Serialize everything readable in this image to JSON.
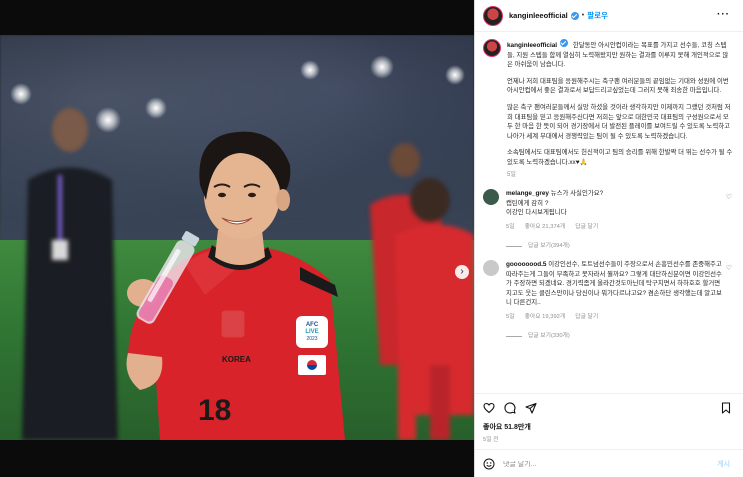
{
  "post": {
    "username": "kanginleeofficial",
    "follow_label": "팔로우",
    "separator": "•",
    "more_label": "···"
  },
  "caption": {
    "username": "kanginleeofficial",
    "paragraphs": [
      "한달동안 아시안컵이라는 목표를 가지고 선수들, 코칭 스텝들, 지원 스텝들 함께 열심히 노력해왔지만 원하는 결과를 이루지 못해 개인적으로 많은 아쉬움이 남습니다.",
      "언제나 저희 대표팀을 응원해주시는 축구팬 여러분들의 끝임없는 기대와 성원에 이번 아시안컵에서 좋은 결과로서 보답드리고싶었는데 그러지 못해 죄송한 마음입니다.",
      "많은 축구 팬여러분들께서 실망 하셨을 것이라 생각하지만 이제까지 그랬던 것처럼 저희 대표팀을 믿고 응원해주신다면 저희는 앞으로 대한민국 대표팀의 구성원으로서 모두 한 마음 한 뜻이 되어 경기장에서 더 발전된 플레이를 보여드릴 수 있도록 노력하고 나아가 세계 무대에서 경쟁력있는 팀이 될 수 있도록 노력하겠습니다.",
      "소속팀에서도 대표팀에서도 헌신적이고 팀의 승리를 위해 한발짝 더 뛰는 선수가 될 수 있도록 노력하겠습니다.xx♥🙏"
    ],
    "time": "5일"
  },
  "comments": [
    {
      "username": "melange_grey",
      "lines": [
        "뉴스가 사실인가요?",
        "캡틴에게 감히 ?",
        "이강인 다시보게됩니다"
      ],
      "time": "5일",
      "likes": "좋아요 21,374개",
      "reply": "답글 달기",
      "replies": "답글 보기(394개)",
      "avatar_color": "#3b5a4a"
    },
    {
      "username": "goooooood.5",
      "lines": [
        "이강인선수, 토트넘선수들이 주장으로서 손흥민선수를 존중해주고 따라주는게 그들이 부족하고 못자라서 뭘까요? 그렇게 대단하신분이면 이강인선수가 주장하면 되겠네요. 경기력좀게 올라간것도아닌데 탁구치면서 하하호호 할거면 지고도 웃는 클린스만이나 당신이나 뭐가다르냐고요? 겸손하단 생각했는데 알고보니 다른건지.."
      ],
      "time": "5일",
      "likes": "좋아요 19,392개",
      "reply": "답글 달기",
      "replies": "답글 보기(330개)",
      "avatar_color": "#c9c9c9"
    }
  ],
  "footer": {
    "likes": "좋아요 51.8만개",
    "when": "5일 전",
    "comment_placeholder": "댓글 달기...",
    "post_label": "게시"
  },
  "photo": {
    "badge_line1": "AFC",
    "badge_line2": "LIVE",
    "badge_line3": "2023",
    "jersey_number": "18",
    "jersey_text": "KOREA",
    "carousel_count": 10,
    "carousel_active": 1
  },
  "colors": {
    "accent": "#0095f6",
    "jersey_red": "#d8232a",
    "pitch_green": "#2f7432"
  }
}
